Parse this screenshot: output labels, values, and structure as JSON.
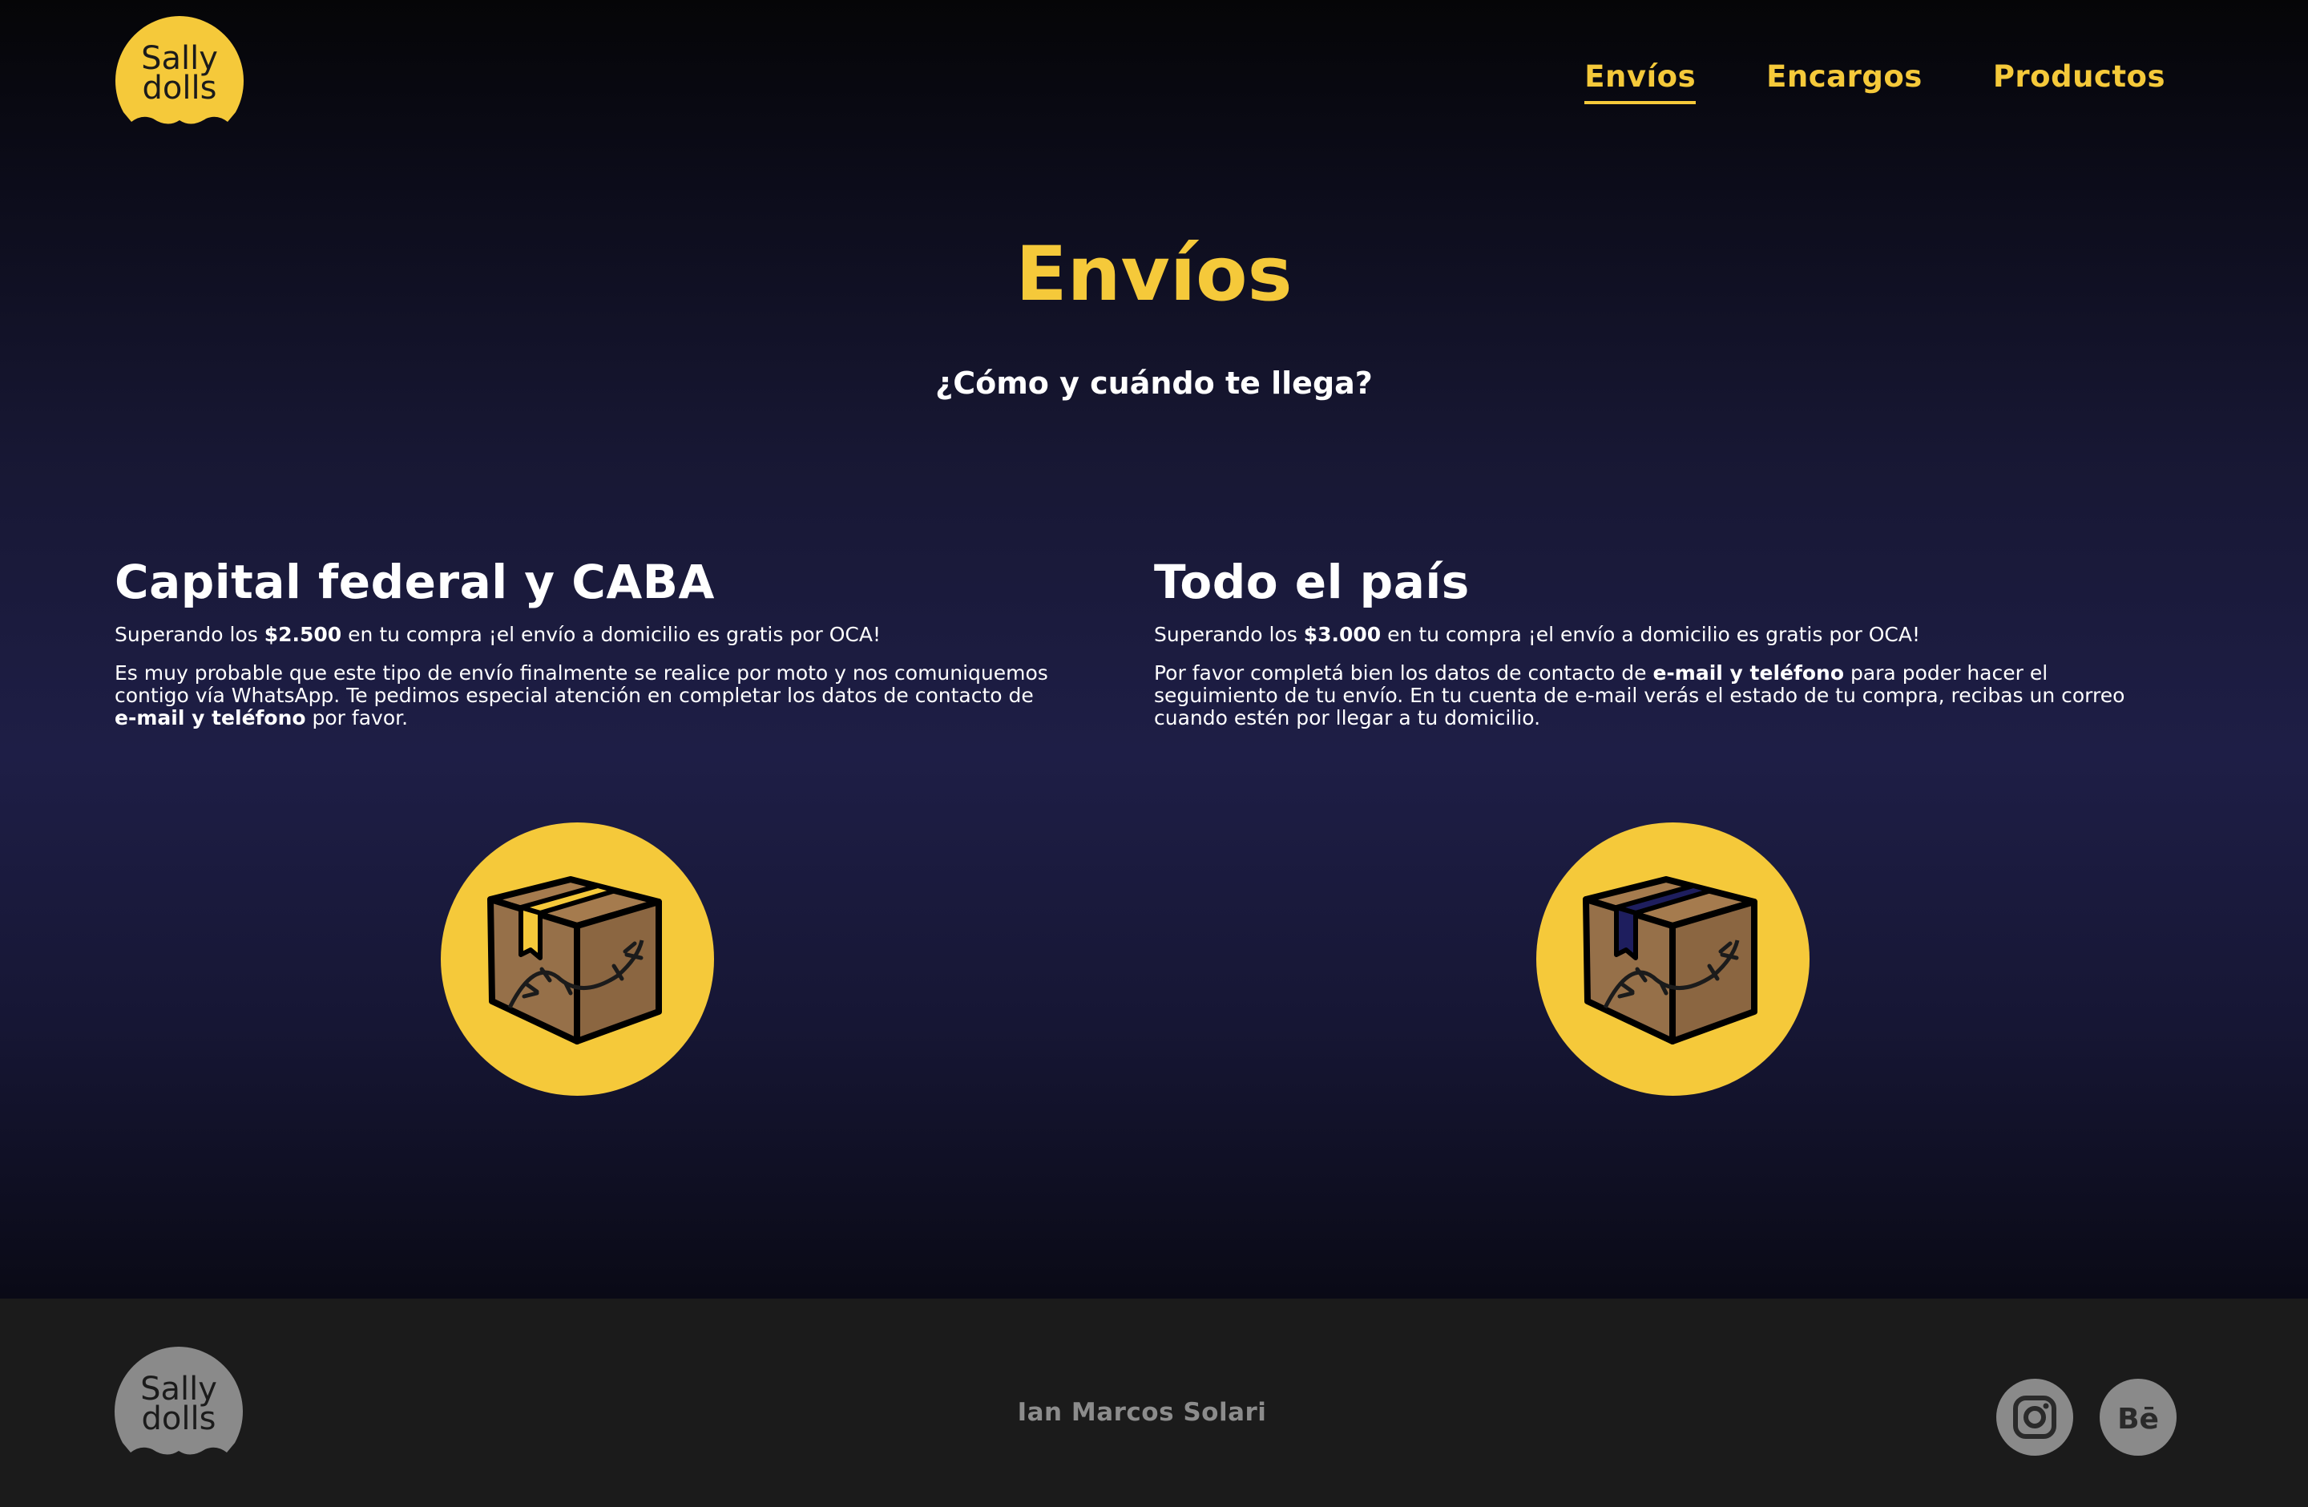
{
  "brand": {
    "logo_line1": "Sally",
    "logo_line2": "dolls",
    "color_primary": "#f5c93a",
    "color_background": "#1e1e46",
    "color_footer": "#1b1b1b"
  },
  "nav": {
    "items": [
      {
        "label": "Envíos",
        "active": true
      },
      {
        "label": "Encargos",
        "active": false
      },
      {
        "label": "Productos",
        "active": false
      }
    ]
  },
  "main": {
    "title": "Envíos",
    "subtitle": "¿Cómo y cuándo te llega?"
  },
  "sections": [
    {
      "heading": "Capital federal y CABA",
      "p1_pre": "Superando los ",
      "p1_bold": "$2.500",
      "p1_post": " en tu compra ¡el envío a domicilio es gratis por OCA!",
      "p2_pre": "Es muy probable que este tipo de envío finalmente se realice por moto y nos comuniquemos contigo vía WhatsApp. Te pedimos especial atención en completar los datos de contacto de ",
      "p2_bold": "e-mail y teléfono",
      "p2_post": " por favor.",
      "icon": "package-box-icon",
      "tape_color": "#f5c93a"
    },
    {
      "heading": "Todo el país",
      "p1_pre": "Superando los ",
      "p1_bold": "$3.000",
      "p1_post": " en tu compra ¡el envío a domicilio es gratis por OCA!",
      "p2_pre": "Por favor completá bien los datos de contacto de ",
      "p2_bold": "e-mail y teléfono",
      "p2_post": " para poder hacer el seguimiento de tu envío. En tu cuenta de e-mail verás el estado de tu compra, recibas un correo cuando estén por llegar a tu domicilio.",
      "icon": "package-box-icon",
      "tape_color": "#1e1e5e"
    }
  ],
  "footer": {
    "credit": "Ian Marcos Solari",
    "social": [
      {
        "name": "instagram-icon"
      },
      {
        "name": "behance-icon"
      }
    ]
  }
}
